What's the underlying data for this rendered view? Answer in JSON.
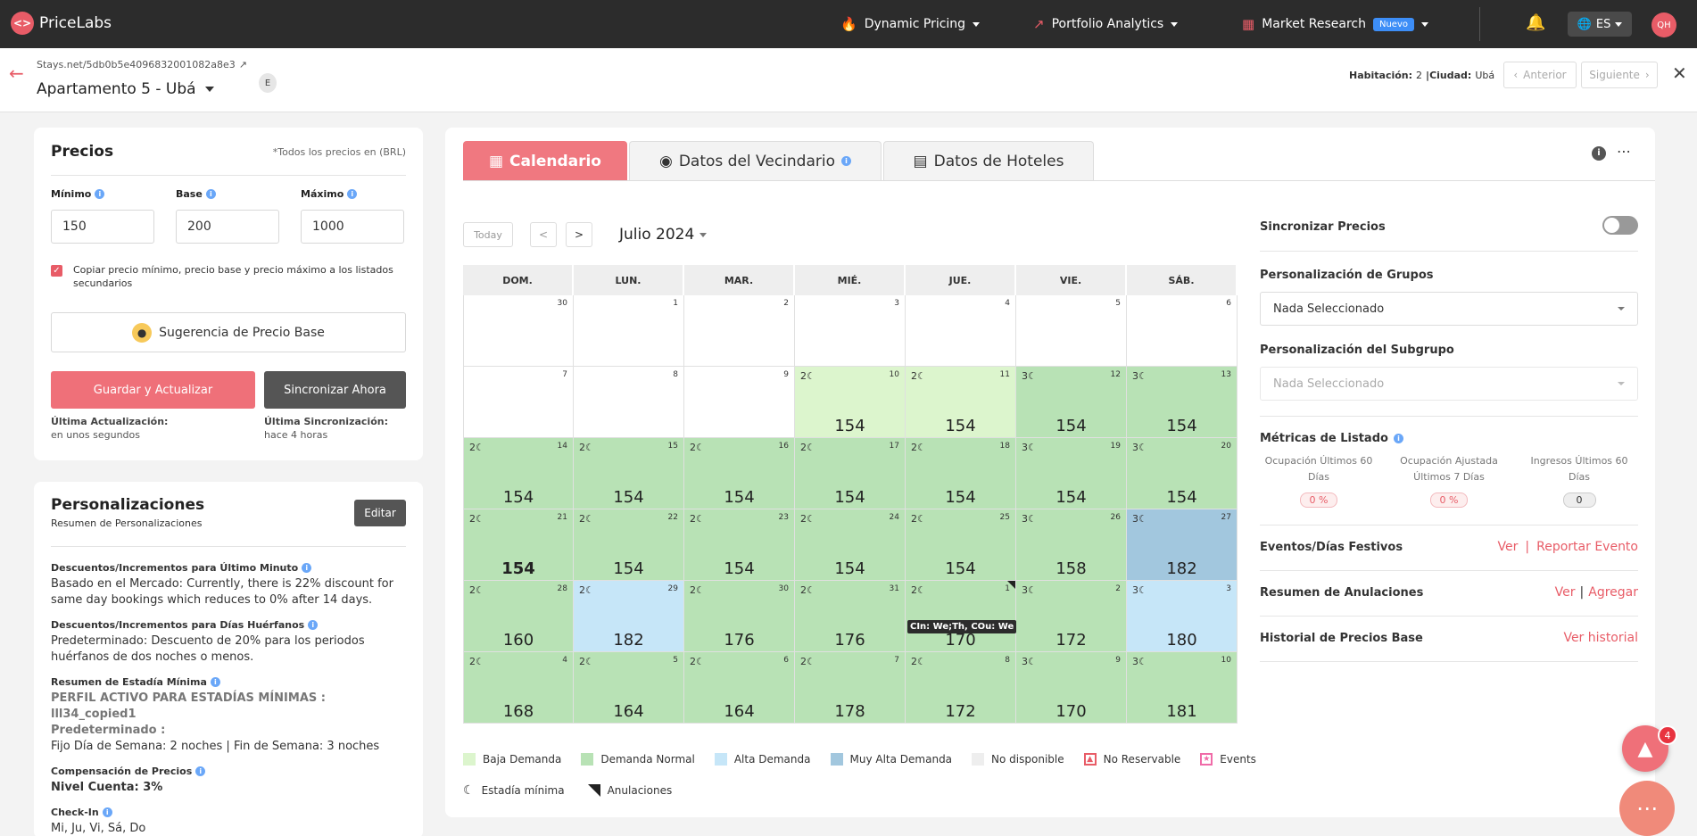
{
  "topbar": {
    "logo_text": "PriceLabs",
    "logo_glyph": "<>",
    "nav": [
      {
        "label": "Dynamic Pricing",
        "icon": "flame-icon"
      },
      {
        "label": "Portfolio Analytics",
        "icon": "trend-icon"
      },
      {
        "label": "Market Research",
        "icon": "grid-icon",
        "badge": "Nuevo"
      }
    ],
    "lang": "ES",
    "avatar": "QH"
  },
  "listing": {
    "source": "Stays.net",
    "id": "/5db0b5e4096832001082a8e3",
    "name": "Apartamento 5 - Ubá",
    "tag": "E",
    "room_label": "Habitación:",
    "room_value": "2",
    "city_label": "|Ciudad:",
    "city_value": "Ubá",
    "prev": "Anterior",
    "next": "Siguiente"
  },
  "prices": {
    "title": "Precios",
    "currency_note": "*Todos los precios en (BRL)",
    "min_label": "Mínimo",
    "min_value": "150",
    "base_label": "Base",
    "base_value": "200",
    "max_label": "Máximo",
    "max_value": "1000",
    "copy_label": "Copiar precio mínimo, precio base y precio máximo a los listados secundarios",
    "suggest_button": "Sugerencia de Precio Base",
    "save_button": "Guardar y Actualizar",
    "sync_button": "Sincronizar Ahora",
    "last_update_label": "Última Actualización:",
    "last_update_value": "en unos segundos",
    "last_sync_label": "Última Sincronización:",
    "last_sync_value": "hace 4 horas"
  },
  "personalizations": {
    "title": "Personalizaciones",
    "subtitle": "Resumen de Personalizaciones",
    "edit_button": "Editar",
    "sections": [
      {
        "title": "Descuentos/Incrementos para Último Minuto",
        "text": "Basado en el Mercado: Currently, there is 22% discount for same day bookings which reduces to 0% after 14 days."
      },
      {
        "title": "Descuentos/Incrementos para Días Huérfanos",
        "text": "Predeterminado: Descuento de 20% para los periodos huérfanos de dos noches o menos."
      },
      {
        "title": "Resumen de Estadía Mínima",
        "profile": "PERFIL ACTIVO PARA ESTADÍAS MÍNIMAS : lll34_copied1",
        "default": "Predeterminado :",
        "text": "Fijo Día de Semana: 2 noches | Fin de Semana: 3 noches"
      },
      {
        "title": "Compensación de Precios",
        "text": "Nivel Cuenta: 3%"
      },
      {
        "title": "Check-In",
        "text": "Mi, Ju, Vi, Sá, Do"
      }
    ]
  },
  "tabs": [
    {
      "label": "Calendario",
      "icon": "calendar-icon"
    },
    {
      "label": "Datos del Vecindario",
      "icon": "pin-icon"
    },
    {
      "label": "Datos de Hoteles",
      "icon": "bed-icon"
    }
  ],
  "calendar": {
    "today": "Today",
    "prev": "<",
    "next": ">",
    "month": "Julio 2024",
    "weekdays": [
      "DOM.",
      "LUN.",
      "MAR.",
      "MIÉ.",
      "JUE.",
      "VIE.",
      "SÁB."
    ],
    "moon": "☾",
    "days": [
      {
        "d": "30"
      },
      {
        "d": "1"
      },
      {
        "d": "2"
      },
      {
        "d": "3"
      },
      {
        "d": "4"
      },
      {
        "d": "5"
      },
      {
        "d": "6"
      },
      {
        "d": "7"
      },
      {
        "d": "8"
      },
      {
        "d": "9"
      },
      {
        "d": "10",
        "m": "2",
        "p": "154",
        "c": "low"
      },
      {
        "d": "11",
        "m": "2",
        "p": "154",
        "c": "low"
      },
      {
        "d": "12",
        "m": "3",
        "p": "154",
        "c": "norm"
      },
      {
        "d": "13",
        "m": "3",
        "p": "154",
        "c": "norm"
      },
      {
        "d": "14",
        "m": "2",
        "p": "154",
        "c": "norm"
      },
      {
        "d": "15",
        "m": "2",
        "p": "154",
        "c": "norm"
      },
      {
        "d": "16",
        "m": "2",
        "p": "154",
        "c": "norm"
      },
      {
        "d": "17",
        "m": "2",
        "p": "154",
        "c": "norm"
      },
      {
        "d": "18",
        "m": "2",
        "p": "154",
        "c": "norm"
      },
      {
        "d": "19",
        "m": "3",
        "p": "154",
        "c": "norm"
      },
      {
        "d": "20",
        "m": "3",
        "p": "154",
        "c": "norm"
      },
      {
        "d": "21",
        "m": "2",
        "p": "154",
        "c": "norm",
        "bold": true
      },
      {
        "d": "22",
        "m": "2",
        "p": "154",
        "c": "norm"
      },
      {
        "d": "23",
        "m": "2",
        "p": "154",
        "c": "norm"
      },
      {
        "d": "24",
        "m": "2",
        "p": "154",
        "c": "norm"
      },
      {
        "d": "25",
        "m": "2",
        "p": "154",
        "c": "norm"
      },
      {
        "d": "26",
        "m": "3",
        "p": "158",
        "c": "norm"
      },
      {
        "d": "27",
        "m": "3",
        "p": "182",
        "c": "vhigh"
      },
      {
        "d": "28",
        "m": "2",
        "p": "160",
        "c": "norm"
      },
      {
        "d": "29",
        "m": "2",
        "p": "182",
        "c": "high"
      },
      {
        "d": "30",
        "m": "2",
        "p": "176",
        "c": "norm"
      },
      {
        "d": "31",
        "m": "2",
        "p": "176",
        "c": "norm"
      },
      {
        "d": "1",
        "m": "2",
        "p": "170",
        "c": "norm",
        "cancel": true,
        "tip": "CIn: We;Th, COu: We"
      },
      {
        "d": "2",
        "m": "3",
        "p": "172",
        "c": "norm"
      },
      {
        "d": "3",
        "m": "3",
        "p": "180",
        "c": "high"
      },
      {
        "d": "4",
        "m": "2",
        "p": "168",
        "c": "norm"
      },
      {
        "d": "5",
        "m": "2",
        "p": "164",
        "c": "norm"
      },
      {
        "d": "6",
        "m": "2",
        "p": "164",
        "c": "norm"
      },
      {
        "d": "7",
        "m": "2",
        "p": "178",
        "c": "norm"
      },
      {
        "d": "8",
        "m": "2",
        "p": "172",
        "c": "norm"
      },
      {
        "d": "9",
        "m": "3",
        "p": "170",
        "c": "norm"
      },
      {
        "d": "10",
        "m": "3",
        "p": "181",
        "c": "norm"
      }
    ]
  },
  "legend": [
    {
      "label": "Baja Demanda",
      "color": "#dcf5cd"
    },
    {
      "label": "Demanda Normal",
      "color": "#b8e2b5"
    },
    {
      "label": "Alta Demanda",
      "color": "#c6e6f8"
    },
    {
      "label": "Muy Alta Demanda",
      "color": "#a2c7de"
    },
    {
      "label": "No disponible",
      "color": "#eeeeee"
    },
    {
      "label": "No Reservable",
      "color": "#e85c67"
    },
    {
      "label": "Events",
      "color": "#f06ba8"
    },
    {
      "label": "Estadía mínima"
    },
    {
      "label": "Anulaciones"
    }
  ],
  "right_panel": {
    "sync_prices": "Sincronizar Precios",
    "groups_label": "Personalización de Grupos",
    "groups_value": "Nada Seleccionado",
    "subgroup_label": "Personalización del Subgrupo",
    "subgroup_value": "Nada Seleccionado",
    "metrics_title": "Métricas de Listado",
    "metrics": [
      {
        "label": "Ocupación Últimos 60 Días",
        "value": "0 %"
      },
      {
        "label": "Ocupación Ajustada Últimos 7 Días",
        "value": "0 %"
      },
      {
        "label": "Ingresos Últimos 60 Días",
        "value": "0"
      }
    ],
    "events_label": "Eventos/Días Festivos",
    "events_view": "Ver",
    "events_sep": "|",
    "events_report": "Reportar Evento",
    "cancel_label": "Resumen de Anulaciones",
    "cancel_view": "Ver",
    "cancel_sep": "|",
    "cancel_add": "Agregar",
    "history_label": "Historial de Precios Base",
    "history_link": "Ver historial"
  },
  "help_badge": "4"
}
